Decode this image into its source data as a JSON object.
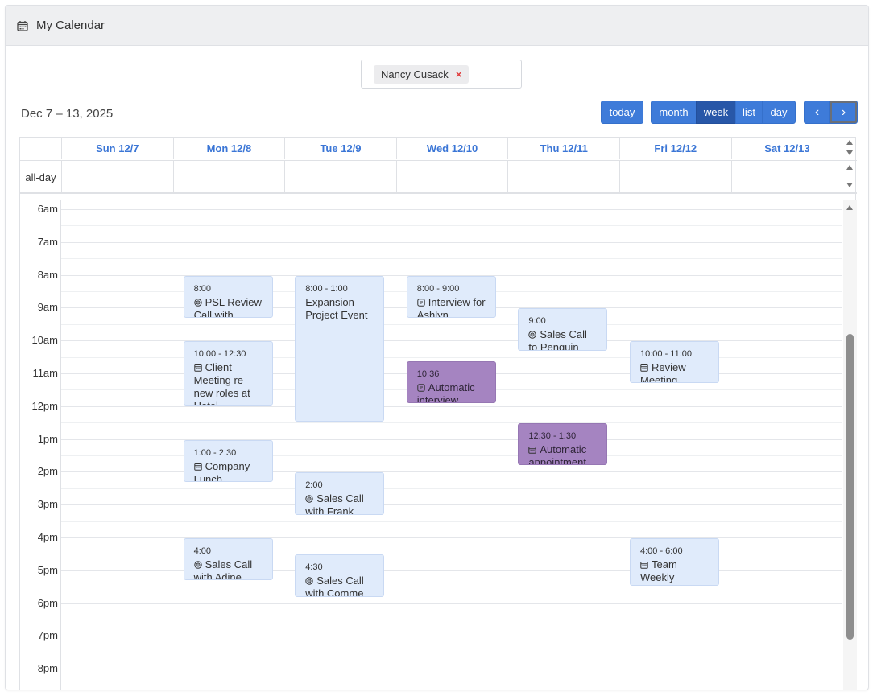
{
  "header": {
    "title": "My Calendar",
    "icon": "calendar-icon"
  },
  "filter": {
    "chip_label": "Nancy Cusack",
    "remove_symbol": "×"
  },
  "toolbar": {
    "date_range": "Dec 7 – 13, 2025",
    "today_label": "today",
    "month_label": "month",
    "week_label": "week",
    "list_label": "list",
    "day_label": "day",
    "prev_symbol": "‹",
    "next_symbol": "›",
    "active_view": "week"
  },
  "calendar": {
    "days": [
      "Sun 12/7",
      "Mon 12/8",
      "Tue 12/9",
      "Wed 12/10",
      "Thu 12/11",
      "Fri 12/12",
      "Sat 12/13"
    ],
    "allday_label": "all-day",
    "hours": [
      "6am",
      "7am",
      "8am",
      "9am",
      "10am",
      "11am",
      "12pm",
      "1pm",
      "2pm",
      "3pm",
      "4pm",
      "5pm",
      "6pm",
      "7pm",
      "8pm"
    ],
    "events": [
      {
        "time": "8:00",
        "title": "PSL Review Call with",
        "icon": "target-icon",
        "day": 1,
        "start": 8.0,
        "end": 9.33,
        "color": "blue"
      },
      {
        "time": "10:00 - 12:30",
        "title": "Client Meeting re new roles at Hotel",
        "icon": "calendar-icon",
        "day": 1,
        "start": 10.0,
        "end": 12.0,
        "color": "blue"
      },
      {
        "time": "1:00 - 2:30",
        "title": "Company Lunch",
        "icon": "calendar-icon",
        "day": 1,
        "start": 13.0,
        "end": 14.33,
        "color": "blue"
      },
      {
        "time": "4:00",
        "title": "Sales Call with Adine",
        "icon": "target-icon",
        "day": 1,
        "start": 16.0,
        "end": 17.33,
        "color": "blue"
      },
      {
        "time": "8:00 - 1:00",
        "title": "Expansion Project Event",
        "icon": "",
        "day": 2,
        "start": 8.0,
        "end": 12.5,
        "color": "blue"
      },
      {
        "time": "2:00",
        "title": "Sales Call with Frank",
        "icon": "target-icon",
        "day": 2,
        "start": 14.0,
        "end": 15.33,
        "color": "blue"
      },
      {
        "time": "4:30",
        "title": "Sales Call with Comme",
        "icon": "target-icon",
        "day": 2,
        "start": 16.5,
        "end": 17.83,
        "color": "blue"
      },
      {
        "time": "8:00 - 9:00",
        "title": "Interview for Ashlyn",
        "icon": "chat-icon",
        "day": 3,
        "start": 8.0,
        "end": 9.33,
        "color": "blue"
      },
      {
        "time": "10:36",
        "title": "Automatic interview",
        "icon": "chat-icon",
        "day": 3,
        "start": 10.6,
        "end": 11.93,
        "color": "purple"
      },
      {
        "time": "9:00",
        "title": "Sales Call to Penguin",
        "icon": "target-icon",
        "day": 4,
        "start": 9.0,
        "end": 10.33,
        "color": "blue"
      },
      {
        "time": "12:30 - 1:30",
        "title": "Automatic appointment",
        "icon": "calendar-icon",
        "day": 4,
        "start": 12.5,
        "end": 13.83,
        "color": "purple"
      },
      {
        "time": "10:00 - 11:00",
        "title": "Review Meeting",
        "icon": "calendar-icon",
        "day": 5,
        "start": 10.0,
        "end": 11.33,
        "color": "blue"
      },
      {
        "time": "4:00 - 6:00",
        "title": "Team Weekly Review",
        "icon": "calendar-icon",
        "day": 5,
        "start": 16.0,
        "end": 17.5,
        "color": "blue"
      }
    ]
  }
}
